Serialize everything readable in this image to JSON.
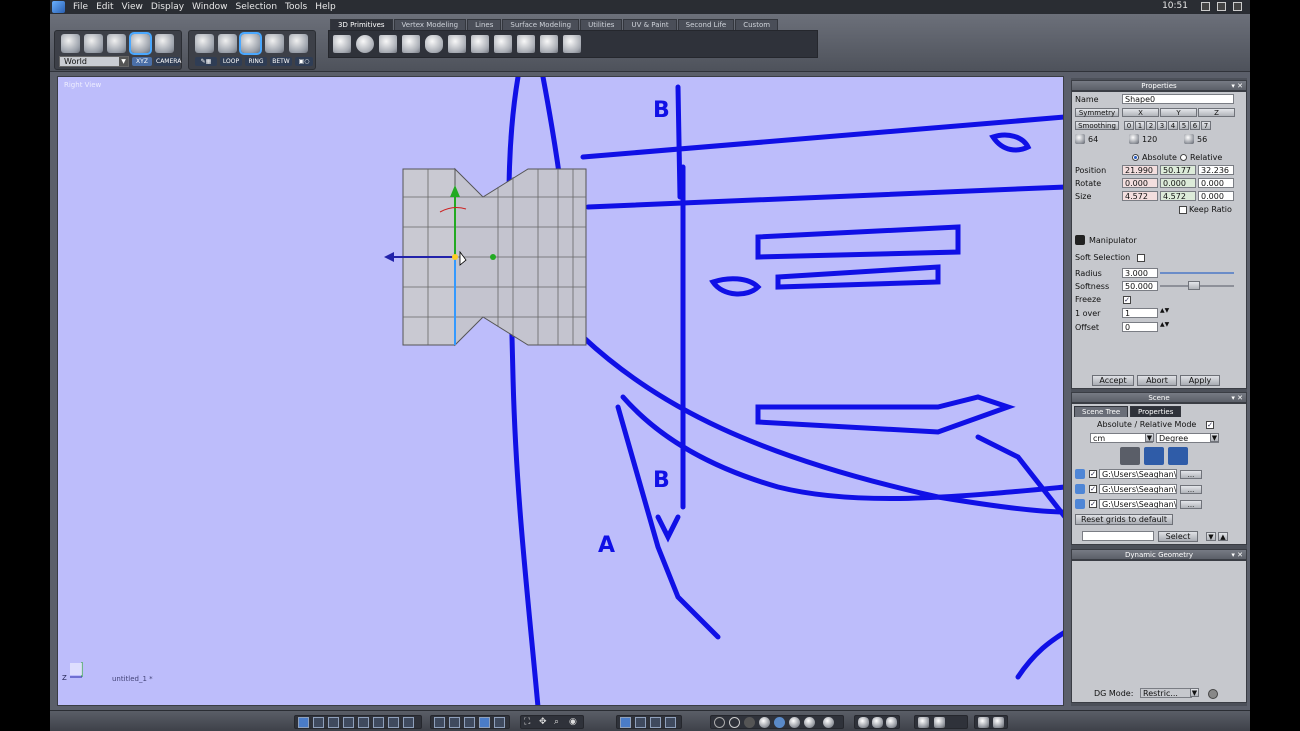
{
  "menubar": {
    "items": [
      "File",
      "Edit",
      "View",
      "Display",
      "Window",
      "Selection",
      "Tools",
      "Help"
    ],
    "clock": "10:51"
  },
  "toolbar": {
    "coord_select": "World",
    "xyz_label": "XYZ",
    "camera_label": "CAMERA",
    "loop_label": "LOOP",
    "ring_label": "RING",
    "betw_label": "BETW",
    "tabs": [
      "3D Primitives",
      "Vertex Modeling",
      "Lines",
      "Surface Modeling",
      "Utilities",
      "UV & Paint",
      "Second Life",
      "Custom"
    ],
    "active_tab": "3D Primitives"
  },
  "viewport": {
    "label": "Right View",
    "filename": "untitled_1 *",
    "axis_z": "Z",
    "bg_color": "#bdbdfb",
    "blueprint_color": "#1010e6"
  },
  "properties": {
    "title": "Properties",
    "name_label": "Name",
    "name_value": "Shape0",
    "symmetry_label": "Symmetry",
    "sym_axes": [
      "X",
      "Y",
      "Z"
    ],
    "smoothing_label": "Smoothing",
    "smoothing_levels": [
      "0",
      "1",
      "2",
      "3",
      "4",
      "5",
      "6",
      "7"
    ],
    "counts": [
      "64",
      "120",
      "56"
    ],
    "absolute_label": "Absolute",
    "relative_label": "Relative",
    "position_label": "Position",
    "position": [
      "21.990",
      "50.177",
      "32.236"
    ],
    "rotate_label": "Rotate",
    "rotate": [
      "0.000",
      "0.000",
      "0.000"
    ],
    "size_label": "Size",
    "size": [
      "4.572",
      "4.572",
      "0.000"
    ],
    "keep_ratio_label": "Keep Ratio",
    "manipulator_label": "Manipulator",
    "soft_selection_label": "Soft Selection",
    "radius_label": "Radius",
    "radius_value": "3.000",
    "softness_label": "Softness",
    "softness_value": "50.000",
    "freeze_label": "Freeze",
    "over_label": "1 over",
    "over_value": "1",
    "offset_label": "Offset",
    "offset_value": "0",
    "accept": "Accept",
    "abort": "Abort",
    "apply": "Apply"
  },
  "scene": {
    "title": "Scene",
    "tab_tree": "Scene Tree",
    "tab_props": "Properties",
    "abs_rel_label": "Absolute / Relative Mode",
    "unit": "cm",
    "angle": "Degree",
    "grids": [
      "G:\\Users\\Seaghan\\",
      "G:\\Users\\Seaghan\\",
      "G:\\Users\\Seaghan\\"
    ],
    "more": "...",
    "reset_grids": "Reset grids to default",
    "select_btn": "Select"
  },
  "dynamic_geometry": {
    "title": "Dynamic Geometry",
    "dg_mode_label": "DG Mode:",
    "dg_mode_value": "Restric..."
  }
}
